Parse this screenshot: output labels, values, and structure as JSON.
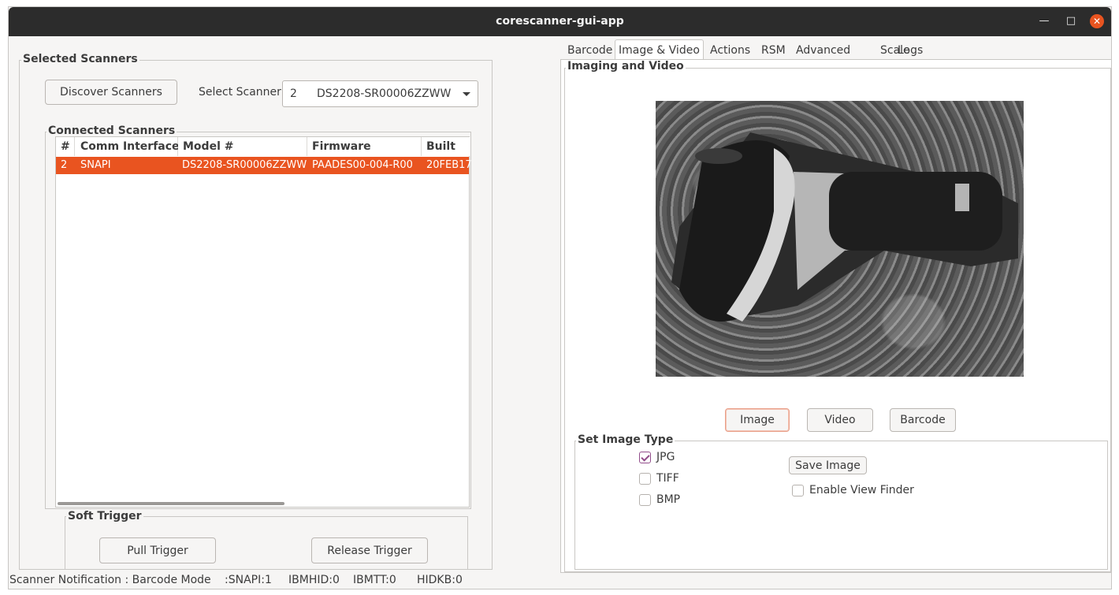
{
  "window": {
    "title": "corescanner-gui-app"
  },
  "left": {
    "selected_scanners_title": "Selected Scanners",
    "discover_button": "Discover Scanners",
    "select_scanner_label": "Select Scanner",
    "select_scanner_value_id": "2",
    "select_scanner_value_name": "DS2208-SR00006ZZWW",
    "connected_title": "Connected Scanners",
    "table": {
      "headers": [
        "#",
        "Comm Interface",
        "Model #",
        "Firmware",
        "Built"
      ],
      "rows": [
        [
          "2",
          "SNAPI",
          "DS2208-SR00006ZZWW",
          "PAADES00-004-R00",
          "20FEB17"
        ]
      ]
    },
    "soft_trigger_title": "Soft Trigger",
    "pull_trigger": "Pull Trigger",
    "release_trigger": "Release Trigger"
  },
  "tabs": [
    "Barcode",
    "Image & Video",
    "Actions",
    "RSM",
    "Advanced",
    "Scale",
    "Logs"
  ],
  "imaging": {
    "title": "Imaging and Video",
    "image_button": "Image",
    "video_button": "Video",
    "barcode_button": "Barcode",
    "set_image_type_title": "Set Image Type",
    "types": [
      {
        "label": "JPG",
        "checked": true
      },
      {
        "label": "TIFF",
        "checked": false
      },
      {
        "label": "BMP",
        "checked": false
      }
    ],
    "save_image": "Save Image",
    "view_finder": {
      "label": "Enable View Finder",
      "checked": false
    }
  },
  "status": {
    "notification": "Scanner Notification : Barcode Mode",
    "snapi": ":SNAPI:1",
    "ibmhid": "IBMHID:0",
    "ibmtt": "IBMTT:0",
    "hidkb": "HIDKB:0"
  },
  "colors": {
    "selection": "#e95420",
    "titlebar": "#2c2c2c",
    "check": "#924d8b"
  }
}
